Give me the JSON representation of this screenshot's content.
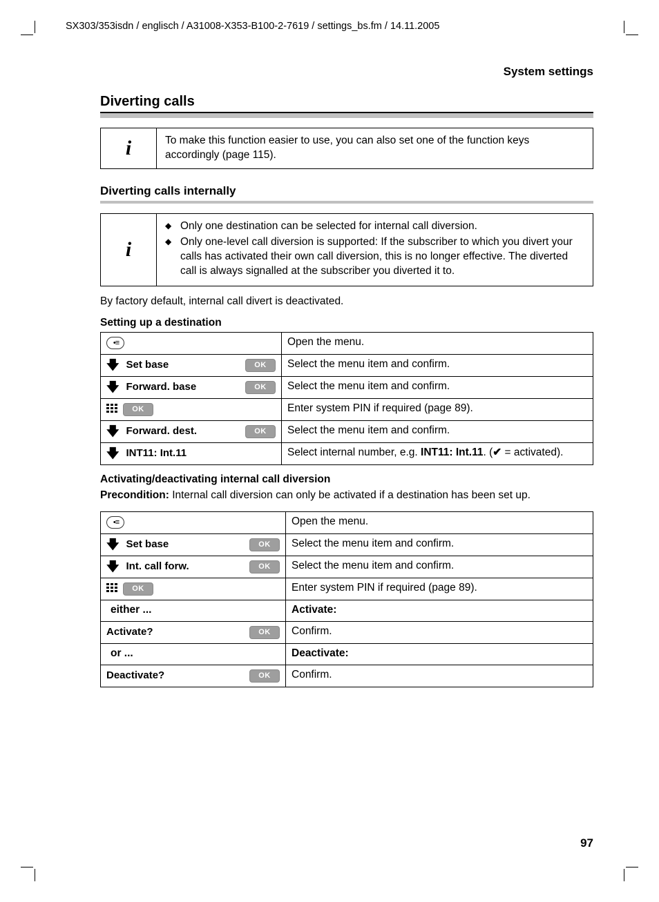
{
  "header_path": "SX303/353isdn / englisch / A31008-X353-B100-2-7619 / settings_bs.fm / 14.11.2005",
  "running_head": "System settings",
  "section_title": "Diverting calls",
  "info1": "To make this function easier to use, you can also set one of the function keys accordingly (page 115).",
  "subsection_title": "Diverting calls internally",
  "info2_bullets": [
    "Only one destination can be selected for internal call diversion.",
    "Only one-level call diversion is supported: If the subscriber to which you divert your calls has activated their own call diversion, this is no longer effective. The diverted call is always signalled at the subscriber you diverted it to."
  ],
  "body1": "By factory default, internal call divert is deactivated.",
  "heading_dest": "Setting up a destination",
  "ok_label": "OK",
  "table1": {
    "r1_right": "Open the menu.",
    "r2_left": "Set base",
    "r2_right": "Select the menu item and confirm.",
    "r3_left": "Forward. base",
    "r3_right": "Select the menu item and confirm.",
    "r4_right": "Enter system PIN if required (page 89).",
    "r5_left": "Forward. dest.",
    "r5_right": "Select the menu item and confirm.",
    "r6_left": "INT11: Int.11",
    "r6_right_pre": "Select internal number, e.g. ",
    "r6_right_bold": "INT11: Int.11",
    "r6_right_post": ". (",
    "r6_right_end": " = activated)."
  },
  "heading_act": "Activating/deactivating internal call diversion",
  "precondition_label": "Precondition:",
  "precondition_text": " Internal call diversion can only be activated if a destination has been set up.",
  "table2": {
    "r1_right": "Open the menu.",
    "r2_left": "Set base",
    "r2_right": "Select the menu item and confirm.",
    "r3_left": "Int. call forw.",
    "r3_right": "Select the menu item and confirm.",
    "r4_right": "Enter system PIN if required (page 89).",
    "either": "either ...",
    "activate_hdr": "Activate:",
    "r6_left": "Activate?",
    "r6_right": "Confirm.",
    "or": "or ...",
    "deactivate_hdr": "Deactivate:",
    "r8_left": "Deactivate?",
    "r8_right": "Confirm."
  },
  "page_number": "97"
}
